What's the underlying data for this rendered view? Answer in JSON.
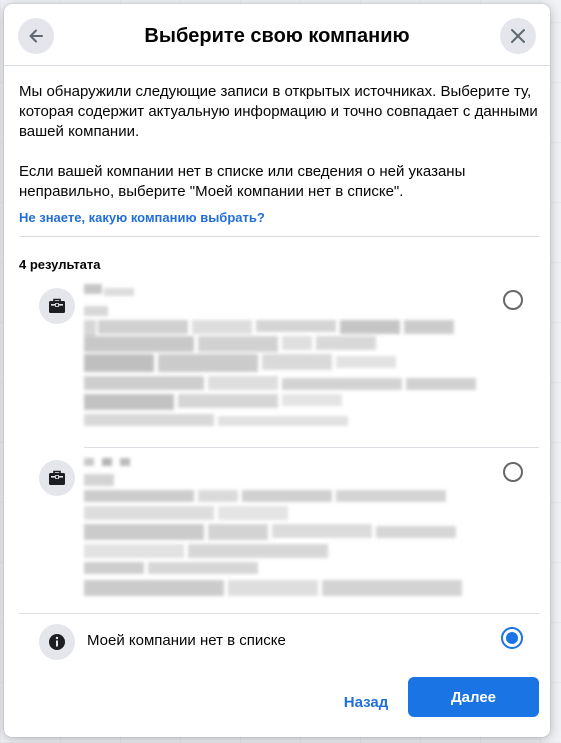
{
  "dialog": {
    "title": "Выберите свою компанию",
    "intro_paragraph_1": "Мы обнаружили следующие записи в открытых источниках. Выберите ту, которая содержит актуальную информацию и точно совпадает с данными вашей компании.",
    "intro_paragraph_2": "Если вашей компании нет в списке или сведения о ней указаны неправильно, выберите \"Моей компании нет в списке\".",
    "help_link": "Не знаете, какую компанию выбрать?",
    "results_count": "4 результата",
    "results": [
      {
        "icon": "briefcase-icon",
        "selected": false
      },
      {
        "icon": "briefcase-icon",
        "selected": false
      }
    ],
    "none_option": {
      "icon": "info-icon",
      "label": "Моей компании нет в списке",
      "selected": true
    },
    "back_label": "Назад",
    "next_label": "Далее"
  },
  "colors": {
    "accent": "#1b74e4",
    "link": "#216fdb",
    "icon_bg": "#e4e6eb"
  }
}
